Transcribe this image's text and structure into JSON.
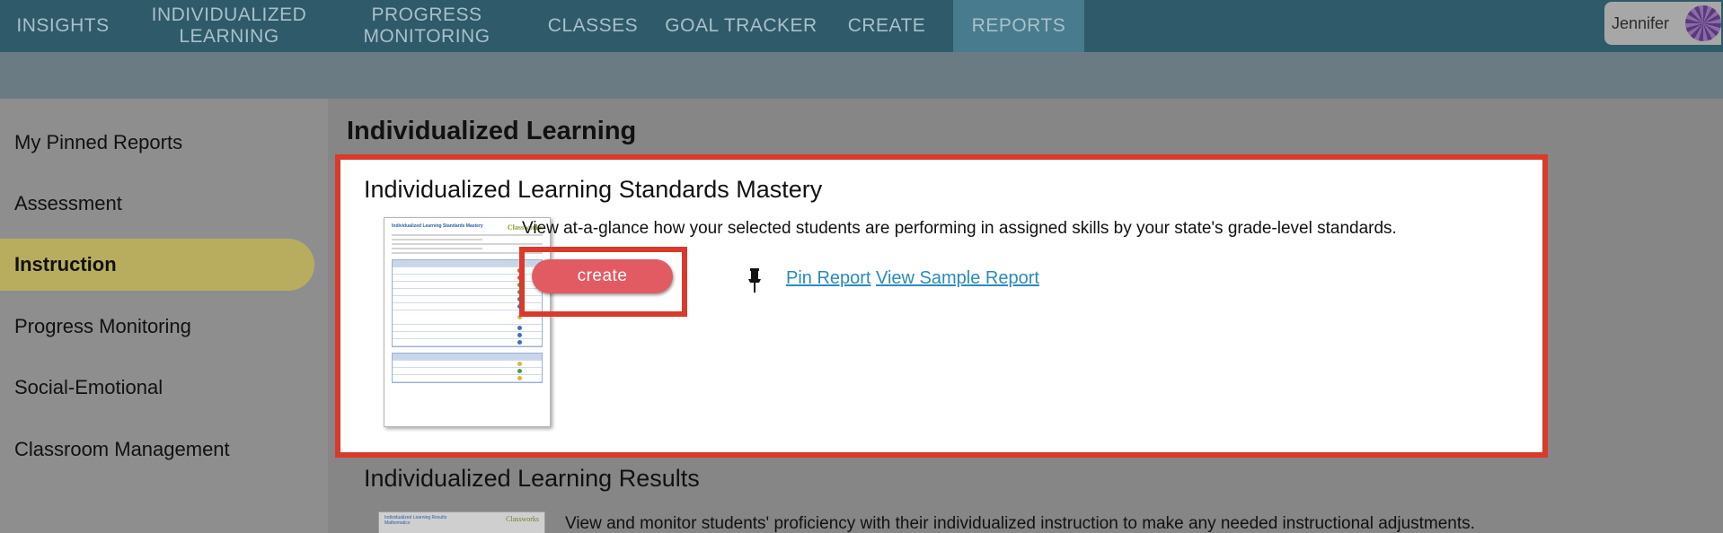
{
  "nav": {
    "items": [
      {
        "label": "INSIGHTS"
      },
      {
        "label": "INDIVIDUALIZED\nLEARNING"
      },
      {
        "label": "PROGRESS\nMONITORING"
      },
      {
        "label": "CLASSES"
      },
      {
        "label": "GOAL TRACKER"
      },
      {
        "label": "CREATE"
      },
      {
        "label": "REPORTS"
      }
    ],
    "active": "REPORTS",
    "user_name": "Jennifer"
  },
  "sidebar": {
    "items": [
      {
        "label": "My Pinned Reports"
      },
      {
        "label": "Assessment"
      },
      {
        "label": "Instruction"
      },
      {
        "label": "Progress Monitoring"
      },
      {
        "label": "Social-Emotional"
      },
      {
        "label": "Classroom Management"
      }
    ],
    "active": "Instruction"
  },
  "main": {
    "title": "Individualized Learning",
    "cards": [
      {
        "title": "Individualized Learning Standards Mastery",
        "description": "View at-a-glance how your selected students are performing in assigned skills by your state's grade-level standards.",
        "create_label": "create",
        "pin_label": "Pin Report",
        "sample_label": "View Sample Report",
        "thumb_title": "Individualized Learning Standards Mastery",
        "thumb_brand": "Classworks"
      },
      {
        "title": "Individualized Learning Results",
        "description": "View and monitor students' proficiency with their individualized instruction to make any needed instructional adjustments.",
        "thumb_title": "Individualized Learning Results\nMathematics",
        "thumb_brand": "Classworks"
      }
    ]
  },
  "colors": {
    "nav_bg": "#2e5a6a",
    "nav_active": "#477b8d",
    "sidebar_active": "#b8ad5f",
    "highlight_border": "#d93a2b",
    "create_button": "#e25b62",
    "link": "#2b8ab9"
  }
}
